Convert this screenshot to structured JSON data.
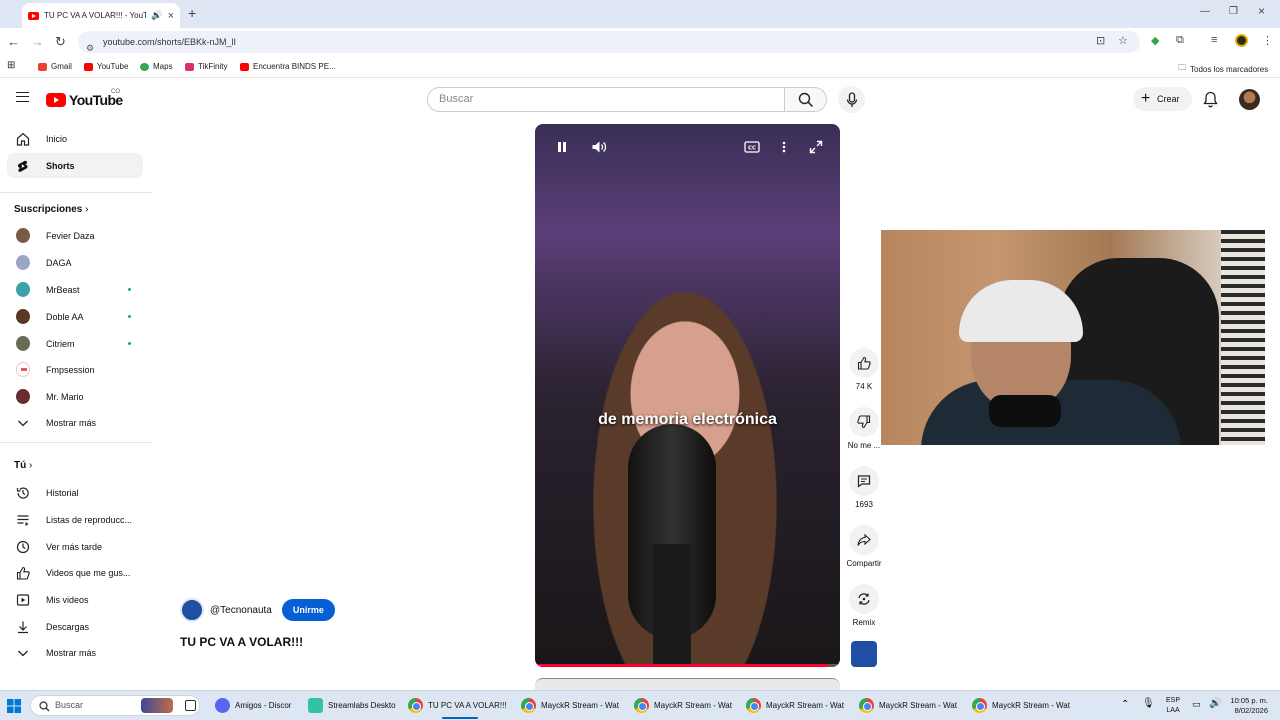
{
  "browser": {
    "tab_title": "TU PC VA A VOLAR!!! - YouTube",
    "url": "youtube.com/shorts/EBKk-nJM_lI",
    "bookmarks": [
      "Gmail",
      "YouTube",
      "Maps",
      "TikFinity",
      "Encuentra BINDS PE..."
    ],
    "all_bookmarks": "Todos los marcadores"
  },
  "header": {
    "logo_text": "YouTube",
    "country_code": "CO",
    "search_placeholder": "Buscar",
    "create_label": "Crear"
  },
  "sidebar": {
    "main": [
      {
        "label": "Inicio",
        "icon": "home-icon"
      },
      {
        "label": "Shorts",
        "icon": "shorts-icon",
        "active": true
      }
    ],
    "subscriptions_heading": "Suscripciones",
    "subscriptions": [
      {
        "label": "Fevier Daza",
        "color": "#7a5a44",
        "live": false
      },
      {
        "label": "DAGA",
        "color": "#9aa7c4",
        "live": false
      },
      {
        "label": "MrBeast",
        "color": "#39a3a8",
        "live": true
      },
      {
        "label": "Doble AA",
        "color": "#5a3824",
        "live": true
      },
      {
        "label": "Citriem",
        "color": "#6a6a58",
        "live": true
      },
      {
        "label": "Fmpsession",
        "color": "#e45a5a",
        "live": false
      },
      {
        "label": "Mr. Mario",
        "color": "#6a2c2c",
        "live": false
      }
    ],
    "show_more": "Mostrar más",
    "you_heading": "Tú",
    "you_items": [
      {
        "label": "Historial",
        "icon": "history-icon"
      },
      {
        "label": "Listas de reproducc...",
        "icon": "playlists-icon"
      },
      {
        "label": "Ver más tarde",
        "icon": "watch-later-icon"
      },
      {
        "label": "Videos que me gus...",
        "icon": "liked-icon"
      },
      {
        "label": "Mis videos",
        "icon": "my-videos-icon"
      },
      {
        "label": "Descargas",
        "icon": "downloads-icon"
      }
    ],
    "show_more_2": "Mostrar más"
  },
  "video": {
    "caption": "de memoria electrónica",
    "progress": 0.96
  },
  "actions": {
    "likes": "74 K",
    "dislike": "No me ...",
    "comments": "1693",
    "share": "Compartir",
    "remix": "Remix"
  },
  "channel": {
    "handle": "@Tecnonauta",
    "join_label": "Unirme",
    "title": "TU PC VA A VOLAR!!!"
  },
  "taskbar": {
    "search_placeholder": "Buscar",
    "items": [
      {
        "label": "Amigos - Discor",
        "kind": "discord"
      },
      {
        "label": "Streamlabs Deskto",
        "kind": "streamlabs"
      },
      {
        "label": "TU PC VA A VOLAR!!!",
        "kind": "chrome",
        "active": true
      },
      {
        "label": "MayckR Stream - Wat",
        "kind": "chrome"
      },
      {
        "label": "MayckR Stream - Wat",
        "kind": "chrome"
      },
      {
        "label": "MayckR Stream - Wat",
        "kind": "chrome"
      },
      {
        "label": "MayckR Stream - Wat",
        "kind": "chrome"
      },
      {
        "label": "MayckR Stream - Wat",
        "kind": "chrome"
      }
    ],
    "lang_top": "ESP",
    "lang_bottom": "LAA",
    "time": "10:05 p. m.",
    "date": "8/02/2026"
  }
}
